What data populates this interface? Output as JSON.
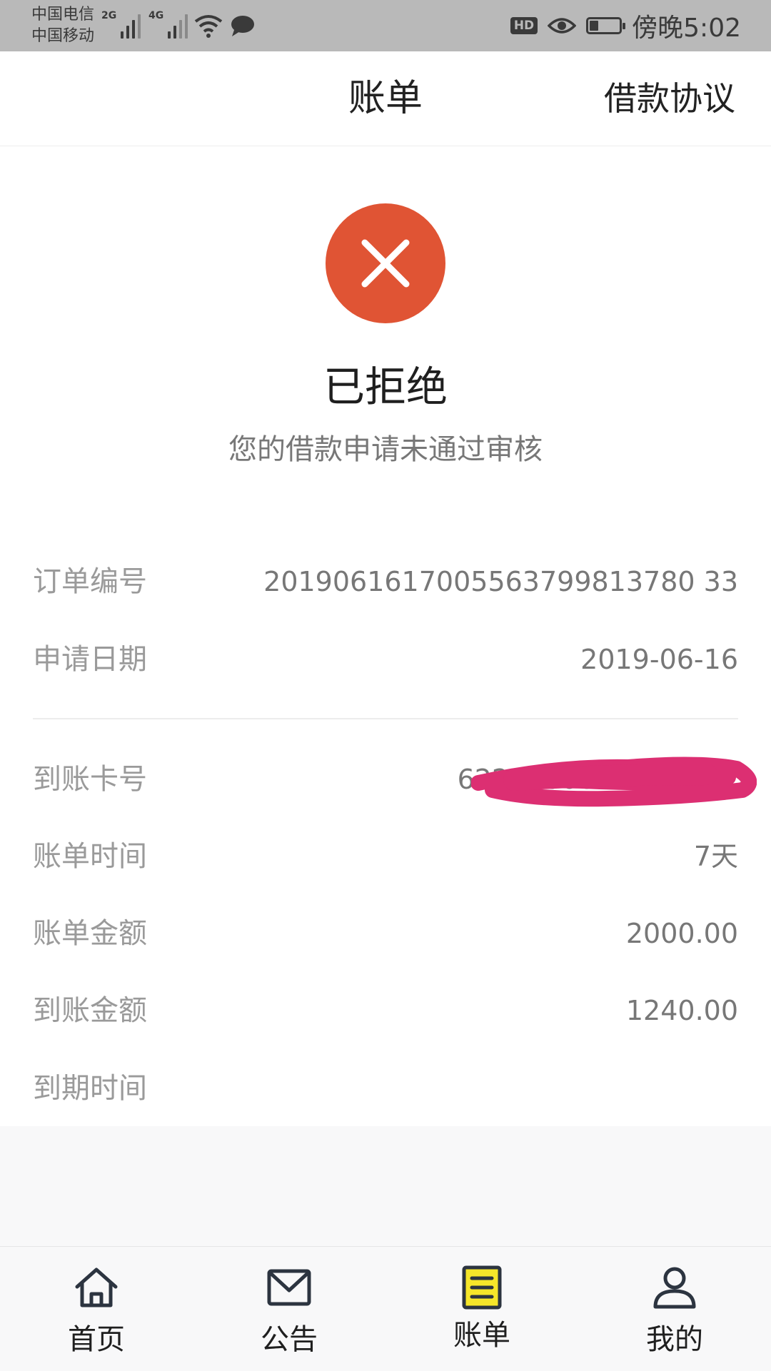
{
  "status_bar": {
    "carrier_1": "中国电信",
    "carrier_2": "中国移动",
    "signal_1_label": "2G",
    "signal_2_label": "4G",
    "hd_label": "HD",
    "battery_level": 0.3,
    "time": "傍晚5:02"
  },
  "header": {
    "title": "账单",
    "agreement_link": "借款协议"
  },
  "status": {
    "icon": "close-icon",
    "icon_color": "#e05434",
    "title": "已拒绝",
    "subtitle": "您的借款申请未通过审核"
  },
  "details": {
    "order_no": {
      "label": "订单编号",
      "value": "2019061617005563799813780 33"
    },
    "apply_date": {
      "label": "申请日期",
      "value": "2019-06-16"
    },
    "card_no": {
      "label": "到账卡号",
      "value": "62270000"
    },
    "bill_period": {
      "label": "账单时间",
      "value": "7天"
    },
    "bill_amount": {
      "label": "账单金额",
      "value": "2000.00"
    },
    "received_amount": {
      "label": "到账金额",
      "value": "1240.00"
    },
    "due_time": {
      "label": "到期时间",
      "value": ""
    }
  },
  "bottom_nav": {
    "items": [
      {
        "label": "首页",
        "icon": "home-icon"
      },
      {
        "label": "公告",
        "icon": "mail-icon"
      },
      {
        "label": "账单",
        "icon": "bill-icon",
        "active": true,
        "highlight_color": "#f6e62a"
      },
      {
        "label": "我的",
        "icon": "user-icon"
      }
    ]
  }
}
